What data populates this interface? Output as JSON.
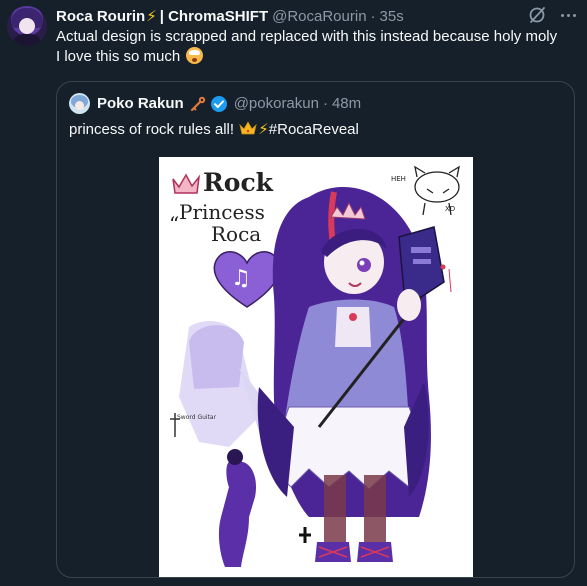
{
  "post": {
    "display_name": "Roca Rourin",
    "name_emoji": "⚡",
    "org_label": "| ChromaSHIFT",
    "handle": "@RocaRourin",
    "separator": "·",
    "timestamp": "35s",
    "text_line1": "Actual design is scrapped and replaced with this instead because holy moly",
    "text_line2": "I love this so much"
  },
  "quoted_post": {
    "display_name": "Poko Rakun",
    "handle": "@pokorakun",
    "separator": "·",
    "timestamp": "48m",
    "text_before": "princess of rock rules all!",
    "bolt": "⚡",
    "hashtag": "#RocaReveal"
  },
  "artwork": {
    "title_line1": "Rock",
    "title_line2": "Princess",
    "title_line3": "Roca",
    "quote_marks": "“",
    "doodle_label_hehe": "HEH",
    "doodle_label_xd": "XD",
    "sword_label": "Sword Guitar"
  },
  "colors": {
    "background": "#15202b",
    "text_primary": "#f7f9f9",
    "text_secondary": "#8b98a5",
    "border": "#38444d",
    "verified": "#1d9bf0",
    "bolt": "#f5c518",
    "hair_purple": "#5b2fa8",
    "hair_highlight": "#d93a5a",
    "dress_lavender": "#8f8ad6",
    "heart_purple": "#8b5fd6"
  },
  "icons": {
    "grok": "grok-icon",
    "more": "more-icon",
    "key": "key-icon",
    "verified": "verified-badge-icon",
    "crown": "crown-emoji"
  }
}
